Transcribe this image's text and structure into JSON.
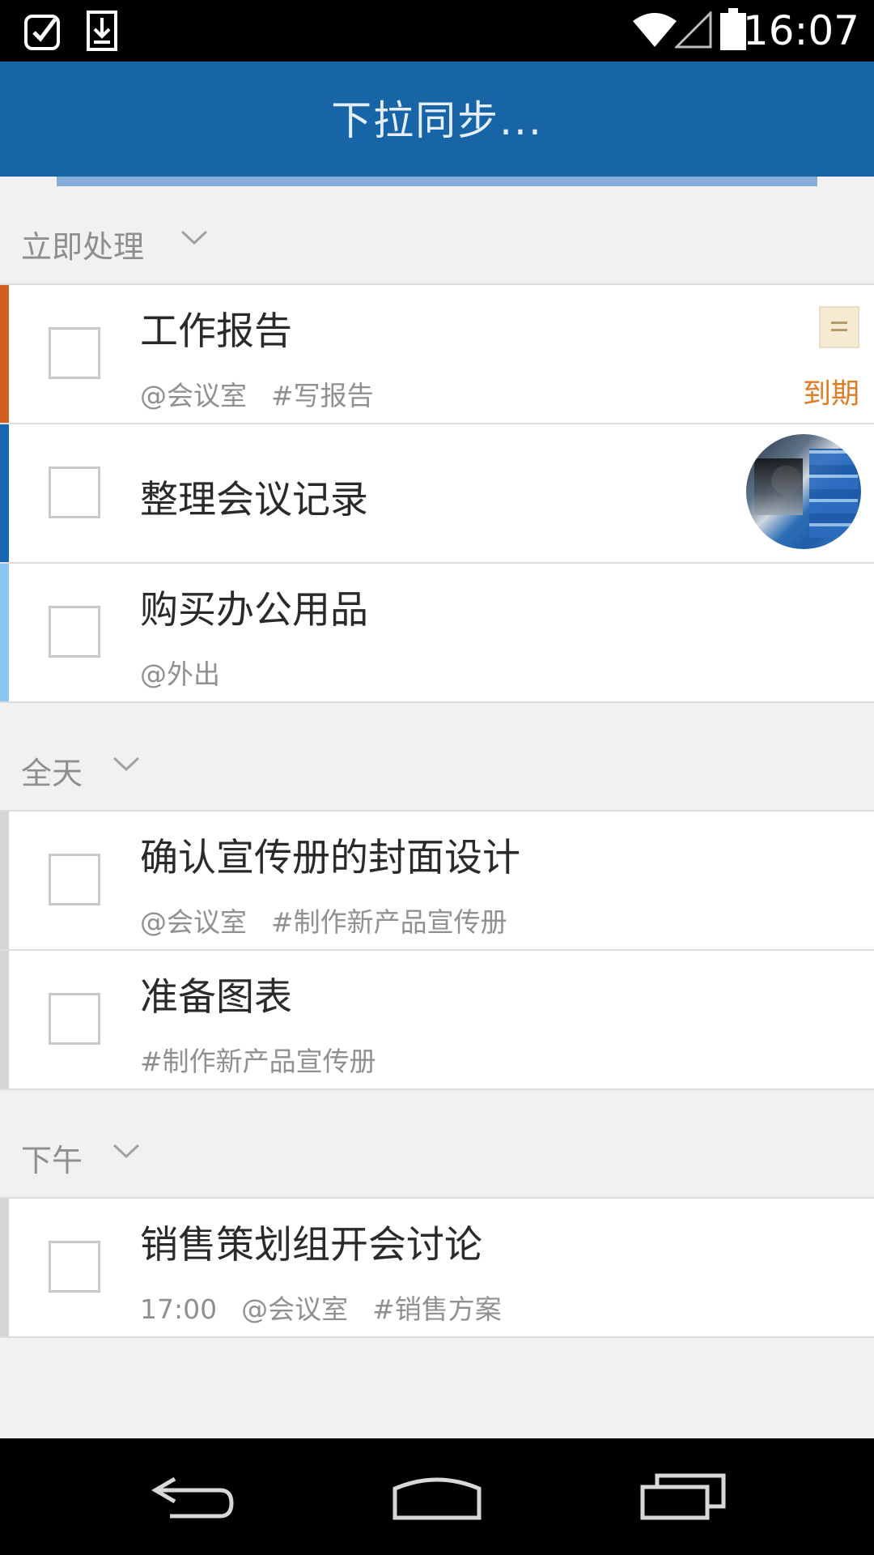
{
  "status_bar": {
    "time": "16:07",
    "icons": [
      "task-check-icon",
      "download-icon",
      "wifi-icon",
      "cell-signal-icon",
      "battery-icon"
    ]
  },
  "action_bar": {
    "title": "下拉同步..."
  },
  "sections": [
    {
      "label": "立即处理",
      "items": [
        {
          "title": "工作报告",
          "meta": [
            "@会议室",
            "#写报告"
          ],
          "due": "到期",
          "accent": "#d15f1f",
          "has_note": true
        },
        {
          "title": "整理会议记录",
          "meta": [],
          "accent": "#1766b3",
          "has_avatar": true
        },
        {
          "title": "购买办公用品",
          "meta": [
            "@外出"
          ],
          "accent": "#8cc6f0"
        }
      ]
    },
    {
      "label": "全天",
      "items": [
        {
          "title": "确认宣传册的封面设计",
          "meta": [
            "@会议室",
            "#制作新产品宣传册"
          ],
          "accent": "#d6d6d6"
        },
        {
          "title": "准备图表",
          "meta": [
            "#制作新产品宣传册"
          ],
          "accent": "#d6d6d6"
        }
      ]
    },
    {
      "label": "下午",
      "items": [
        {
          "title": "销售策划组开会讨论",
          "meta": [
            "17:00",
            "@会议室",
            "#销售方案"
          ],
          "accent": "#d6d6d6"
        }
      ]
    }
  ],
  "nav_bar": {
    "icons": [
      "back-icon",
      "home-icon",
      "recent-apps-icon"
    ]
  },
  "colors": {
    "action_bar": "#1764a6",
    "due": "#e07c22",
    "background": "#f1f1f1"
  }
}
